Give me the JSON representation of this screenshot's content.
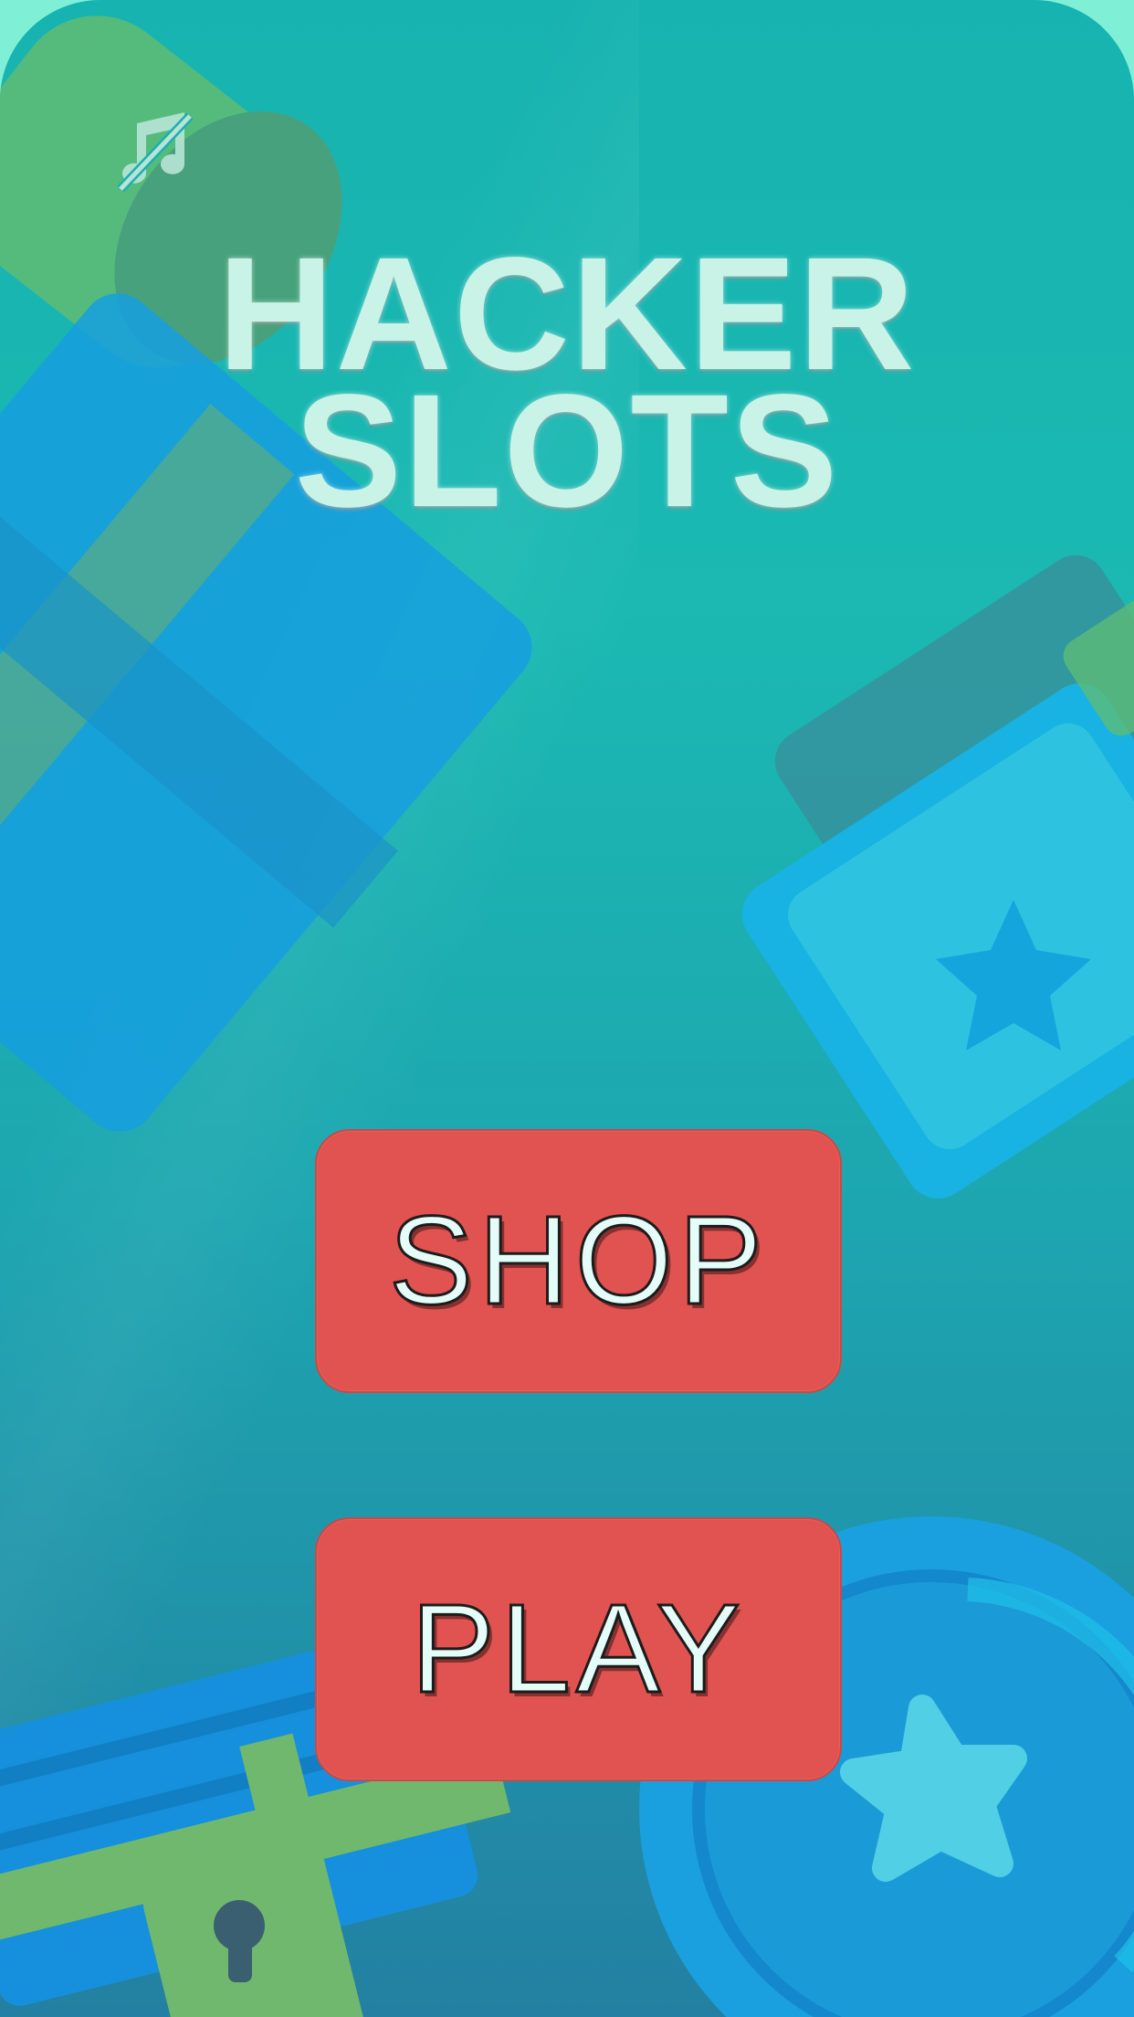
{
  "title": {
    "line1": "HACKER",
    "line2": "SLOTS"
  },
  "buttons": {
    "shop_label": "SHOP",
    "play_label": "PLAY"
  },
  "icons": {
    "music": "music-off-icon"
  },
  "colors": {
    "background_top": "#17b3b0",
    "background_bottom": "#2380a2",
    "button": "#e05350",
    "button_text": "#e4fdf9",
    "title_text": "#c9f3e6",
    "outer_frame": "#7ff0d6"
  }
}
